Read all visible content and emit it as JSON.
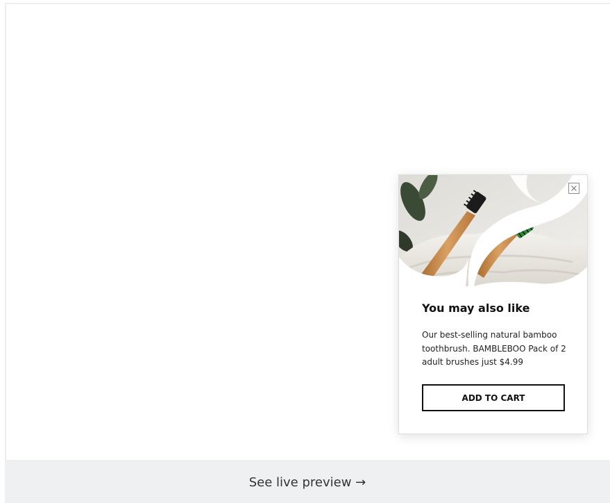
{
  "popup": {
    "title": "You may also like",
    "description": "Our best-selling natural bamboo toothbrush. BAMBLEBOO Pack of 2 adult brushes just $4.99",
    "cta_label": "ADD TO CART",
    "image_alt": "Two bamboo toothbrushes resting on a white towel",
    "close_icon": "close-icon"
  },
  "footer": {
    "preview_link": "See live preview →"
  },
  "colors": {
    "preview_bar": "#eef0f2",
    "button_border": "#111111",
    "bamboo": "#c88a45",
    "bristle_green": "#3da24a"
  }
}
